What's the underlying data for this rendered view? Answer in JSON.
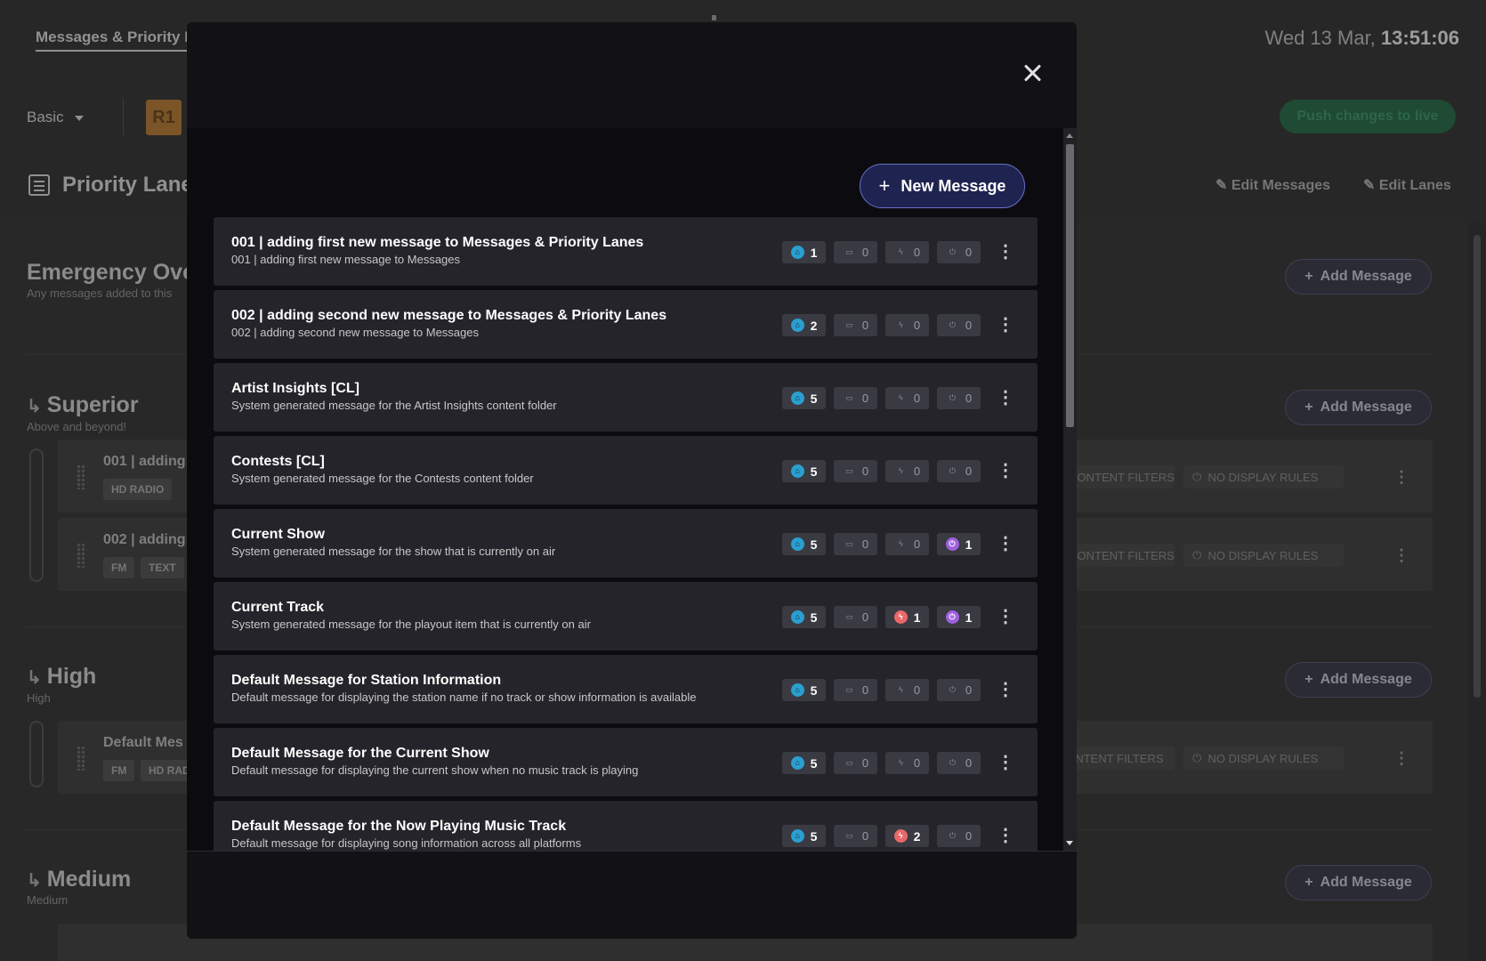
{
  "background": {
    "tab_label": "Messages & Priority L",
    "clock_date": "Wed 13 Mar,",
    "clock_time": "13:51:06",
    "mode_label": "Basic",
    "station_badge": "R1",
    "push_button": "Push changes to live",
    "page_title": "Priority Lanes",
    "edit_messages": "Edit Messages",
    "edit_lanes": "Edit Lanes",
    "add_message_label": "Add Message",
    "lanes": [
      {
        "title": "Emergency Over",
        "subtitle": "Any messages added to this"
      },
      {
        "title": "Superior",
        "subtitle": "Above and beyond!"
      },
      {
        "title": "High",
        "subtitle": "High"
      },
      {
        "title": "Medium",
        "subtitle": "Medium"
      }
    ],
    "rows": [
      {
        "title": "001 | adding",
        "chips": [
          "HD RADIO"
        ],
        "filters": "NO CONTENT FILTERS",
        "rules": "NO DISPLAY RULES"
      },
      {
        "title": "002 | adding",
        "chips": [
          "FM",
          "TEXT"
        ],
        "filters": "NO CONTENT FILTERS",
        "rules": "NO DISPLAY RULES"
      },
      {
        "title": "Default Mes",
        "chips": [
          "FM",
          "HD RAD"
        ],
        "filters": "2 CONTENT FILTERS",
        "rules": "NO DISPLAY RULES"
      }
    ]
  },
  "modal": {
    "new_message_label": "New Message",
    "colors": {
      "broadcast": "#2a9fd0",
      "trigger": "#e8686a",
      "power": "#a060e0",
      "accent": "#6870c8"
    },
    "messages": [
      {
        "title": "001 | adding first new message to Messages & Priority Lanes",
        "subtitle": "001 | adding first new message to Messages",
        "counts": {
          "broadcast": "1",
          "schedule": "0",
          "trigger": "0",
          "power": "0"
        }
      },
      {
        "title": "002 | adding second new message to Messages & Priority Lanes",
        "subtitle": "002 | adding second new message to Messages",
        "counts": {
          "broadcast": "2",
          "schedule": "0",
          "trigger": "0",
          "power": "0"
        }
      },
      {
        "title": "Artist Insights [CL]",
        "subtitle": "System generated message for the Artist Insights content folder",
        "counts": {
          "broadcast": "5",
          "schedule": "0",
          "trigger": "0",
          "power": "0"
        }
      },
      {
        "title": "Contests [CL]",
        "subtitle": "System generated message for the Contests content folder",
        "counts": {
          "broadcast": "5",
          "schedule": "0",
          "trigger": "0",
          "power": "0"
        }
      },
      {
        "title": "Current Show",
        "subtitle": "System generated message for the show that is currently on air",
        "counts": {
          "broadcast": "5",
          "schedule": "0",
          "trigger": "0",
          "power": "1"
        }
      },
      {
        "title": "Current Track",
        "subtitle": "System generated message for the playout item that is currently on air",
        "counts": {
          "broadcast": "5",
          "schedule": "0",
          "trigger": "1",
          "power": "1"
        }
      },
      {
        "title": "Default Message for Station Information",
        "subtitle": "Default message for displaying the station name if no track or show information is available",
        "counts": {
          "broadcast": "5",
          "schedule": "0",
          "trigger": "0",
          "power": "0"
        }
      },
      {
        "title": "Default Message for the Current Show",
        "subtitle": "Default message for displaying the current show when no music track is playing",
        "counts": {
          "broadcast": "5",
          "schedule": "0",
          "trigger": "0",
          "power": "0"
        }
      },
      {
        "title": "Default Message for the Now Playing Music Track",
        "subtitle": "Default message for displaying song information across all platforms",
        "counts": {
          "broadcast": "5",
          "schedule": "0",
          "trigger": "2",
          "power": "0"
        }
      }
    ]
  }
}
